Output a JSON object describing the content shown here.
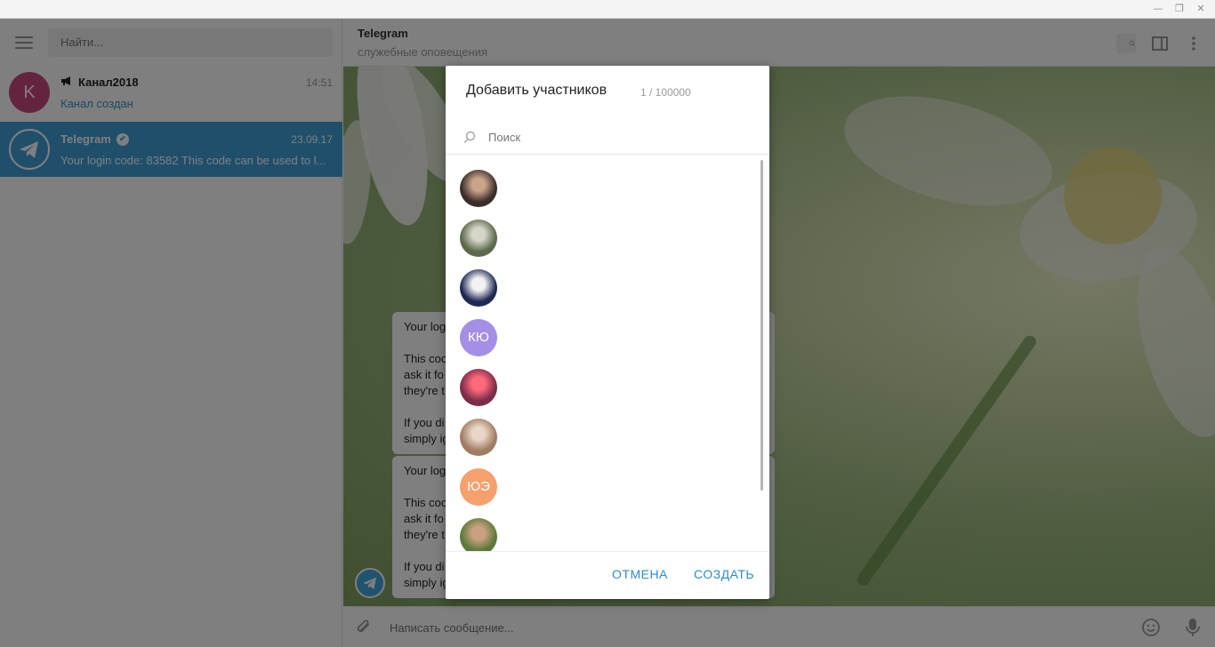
{
  "window": {
    "minimize_glyph": "—",
    "maximize_glyph": "❐",
    "close_glyph": "✕"
  },
  "sidebar": {
    "search_placeholder": "Найти...",
    "chats": [
      {
        "avatar_letter": "K",
        "avatar_color": "#c9487f",
        "name": "Канал2018",
        "time": "14:51",
        "preview": "Канал создан",
        "icon": "megaphone-icon"
      },
      {
        "name": "Telegram",
        "time": "23.09.17",
        "preview": "Your login code: 83582  This code can be used to l...",
        "icon": "verified-icon",
        "selected": true,
        "selected_color": "#419fd9"
      }
    ]
  },
  "chat": {
    "title": "Telegram",
    "subtitle": "служебные оповещения",
    "messages": [
      {
        "lines": [
          "Your log",
          "This coo",
          "ask it fo",
          "they're t",
          "If you di",
          "simply ig"
        ]
      },
      {
        "lines": [
          "Your log",
          "This coo",
          "ask it fo",
          "they're t",
          "If you di",
          "simply ig"
        ]
      }
    ],
    "compose_placeholder": "Написать сообщение..."
  },
  "modal": {
    "title": "Добавить участников",
    "count": "1 / 100000",
    "search_placeholder": "Поиск",
    "members": [
      {
        "type": "photo",
        "colors": [
          "#3a2e2a",
          "#c9a48a"
        ]
      },
      {
        "type": "photo",
        "colors": [
          "#5b6a4c",
          "#d7d4c8"
        ]
      },
      {
        "type": "photo",
        "colors": [
          "#1d2a55",
          "#f2f2f2"
        ]
      },
      {
        "type": "letter",
        "letters": "КЮ",
        "color": "#a58ee6"
      },
      {
        "type": "photo",
        "colors": [
          "#7c2c4a",
          "#ff6a7a"
        ]
      },
      {
        "type": "photo",
        "colors": [
          "#a17c62",
          "#e9d6c8"
        ]
      },
      {
        "type": "letter",
        "letters": "ЮЭ",
        "color": "#f5a06d"
      },
      {
        "type": "photo",
        "colors": [
          "#5b7a3a",
          "#caa083"
        ]
      }
    ],
    "cancel_label": "ОТМЕНА",
    "create_label": "СОЗДАТЬ"
  },
  "colors": {
    "accent": "#2b8ccc",
    "selected_chat": "#419fd9"
  }
}
